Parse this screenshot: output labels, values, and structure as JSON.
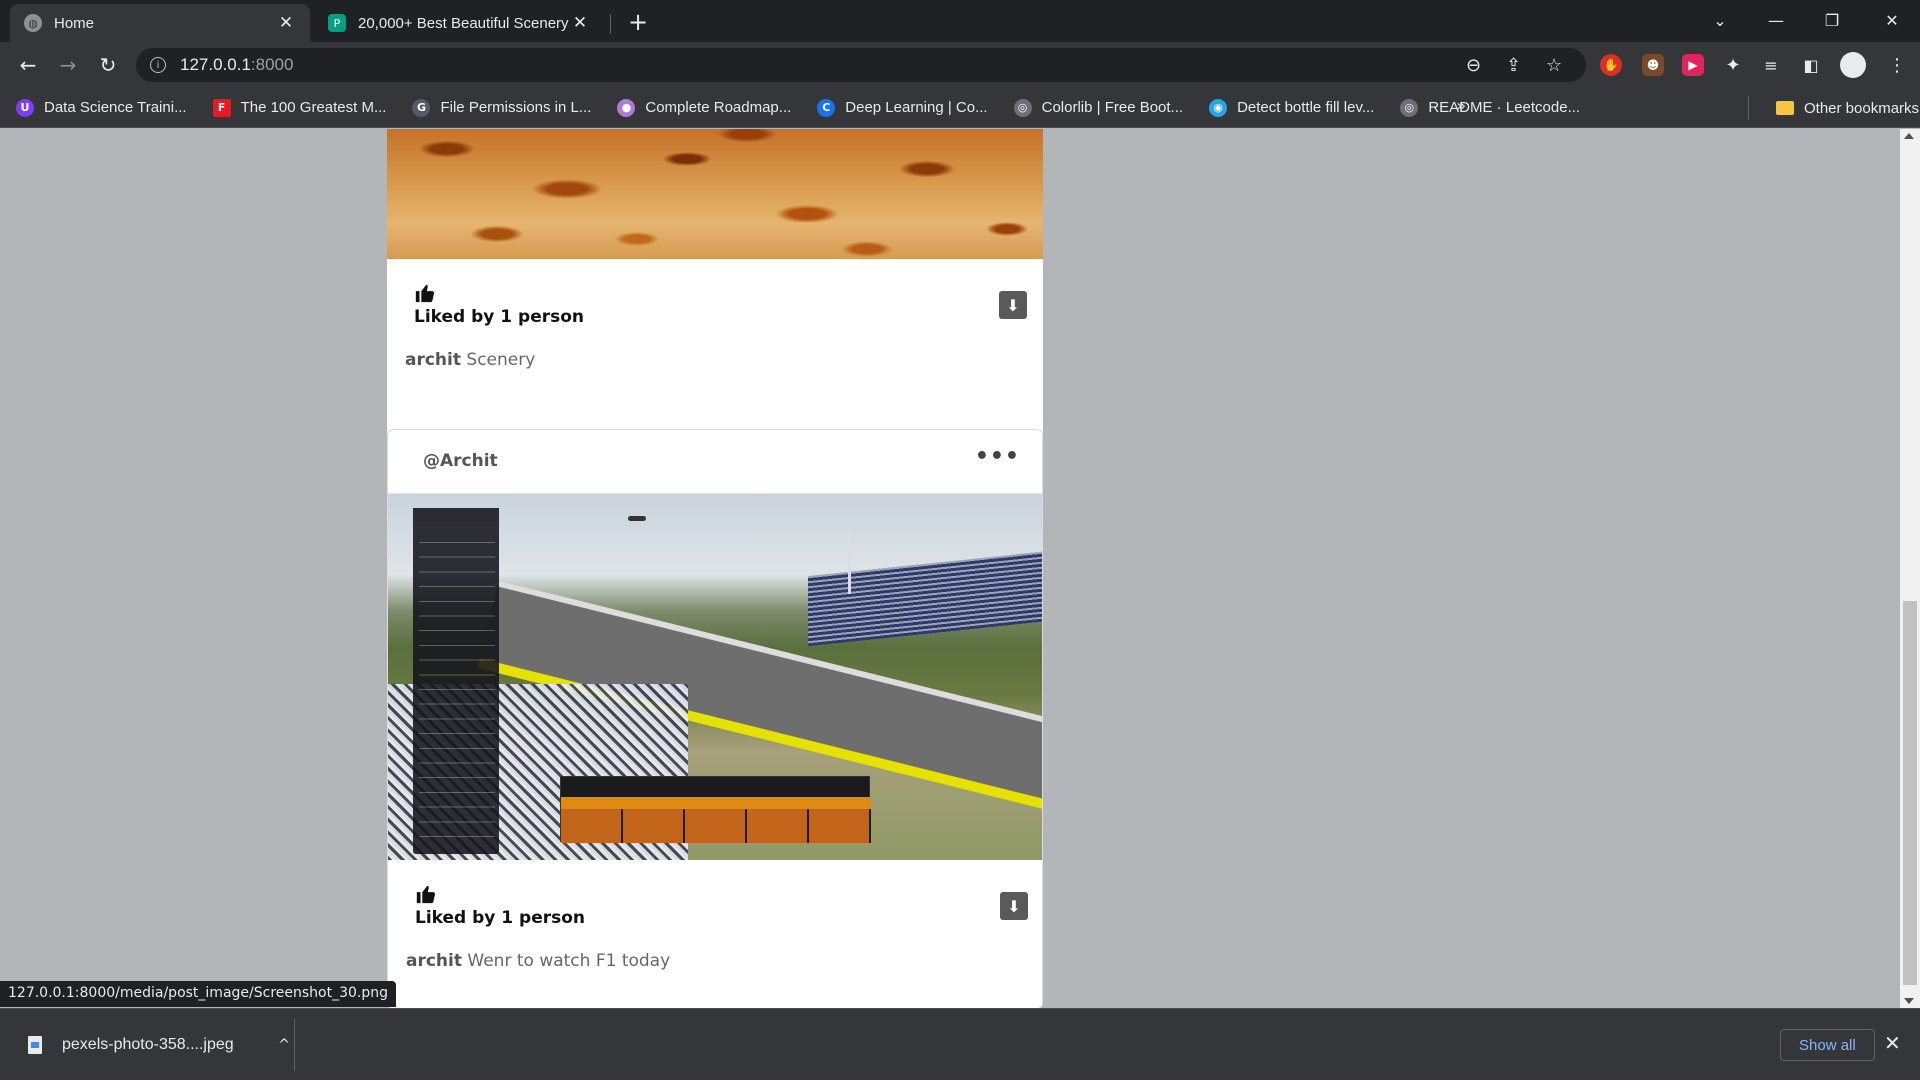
{
  "browser": {
    "tabs": [
      {
        "title": "Home",
        "active": true
      },
      {
        "title": "20,000+ Best Beautiful Scenery P",
        "active": false
      }
    ],
    "tab_close": "✕",
    "new_tab": "+",
    "window_controls": {
      "menu": "⌄",
      "minimize": "—",
      "restore": "❐",
      "close": "✕"
    },
    "nav": {
      "back": "←",
      "forward": "→",
      "reload": "↻"
    },
    "address": {
      "host": "127.0.0.1",
      "port": ":8000"
    },
    "omnibox_icons": {
      "zoom": "⊖",
      "share": "⇪",
      "star": "☆"
    },
    "bookmarks": [
      {
        "label": "Data Science Traini...",
        "icon_color": "#7e3ff2",
        "glyph": "U"
      },
      {
        "label": "The 100 Greatest M...",
        "icon_color": "#e31b23",
        "glyph": "F"
      },
      {
        "label": "File Permissions in L...",
        "icon_color": "#555a66",
        "glyph": "G"
      },
      {
        "label": "Complete Roadmap...",
        "icon_color": "#b07ad6",
        "glyph": "●"
      },
      {
        "label": "Deep Learning | Co...",
        "icon_color": "#1a73e8",
        "glyph": "C"
      },
      {
        "label": "Colorlib | Free Boot...",
        "icon_color": "#6b6f76",
        "glyph": "◎"
      },
      {
        "label": "Detect bottle fill lev...",
        "icon_color": "#27a5e0",
        "glyph": "◉"
      },
      {
        "label": "README · Leetcode...",
        "icon_color": "#6b6f76",
        "glyph": "◎"
      }
    ],
    "bookmarks_more": "»",
    "other_bookmarks": "Other bookmarks",
    "status_url": "127.0.0.1:8000/media/post_image/Screenshot_30.png"
  },
  "posts": [
    {
      "liked_text": "Liked by 1 person",
      "author": "archit",
      "caption": "Scenery",
      "download_icon": "⬇"
    },
    {
      "username": "@Archit",
      "more": "•••",
      "liked_text": "Liked by 1 person",
      "author": "archit",
      "caption": "Wenr to watch F1 today",
      "download_icon": "⬇"
    }
  ],
  "downloads": {
    "file_name": "pexels-photo-358....jpeg",
    "chevron": "^",
    "show_all": "Show all",
    "close": "✕"
  }
}
